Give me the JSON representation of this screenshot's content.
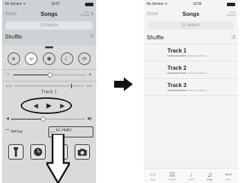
{
  "left": {
    "status": {
      "carrier": "No Service ᯤ",
      "time": "10:07"
    },
    "nav": {
      "back": "Store",
      "title": "Songs",
      "now_playing": "Now\nPlaying"
    },
    "search": {
      "placeholder": "Q Search"
    },
    "shuffle": {
      "label": "Shuffle",
      "icon": "⤮"
    },
    "control_center": {
      "toggles": [
        "✈",
        "ᯤ",
        "✱",
        "☾",
        "⟳"
      ],
      "time_elapsed": "0:02",
      "time_remaining": "-0:57",
      "track_name": "Track 1",
      "airdrop_label": "AirDrop",
      "airplay_label": "KC-HMBC",
      "airplay_sub": "••••••",
      "tools": [
        "flashlight-icon",
        "clock-icon",
        "calculator-icon",
        "camera-icon"
      ]
    }
  },
  "right": {
    "status": {
      "carrier": "No Service ᯤ",
      "time": "10:06"
    },
    "nav": {
      "back": "Store",
      "title": "Songs",
      "now_playing": "Now\nPlaying"
    },
    "search": {
      "placeholder": "Q Search"
    },
    "shuffle": {
      "label": "Shuffle",
      "icon": "⤮"
    },
    "tracks": [
      {
        "title": "Track 1",
        "artist": "Unknown Artist",
        "album": "Unknown Album"
      },
      {
        "title": "Track 2",
        "artist": "Unknown Artist",
        "album": "Unknown Album"
      },
      {
        "title": "Track 3",
        "artist": "Unknown Artist",
        "album": "Unknown Album"
      }
    ],
    "tabs": [
      {
        "label": "Radio",
        "icon": "▭"
      },
      {
        "label": "Playlists",
        "icon": "▤"
      },
      {
        "label": "Artists",
        "icon": "♪"
      },
      {
        "label": "Songs",
        "icon": "♫"
      },
      {
        "label": "More",
        "icon": "•••"
      }
    ]
  }
}
